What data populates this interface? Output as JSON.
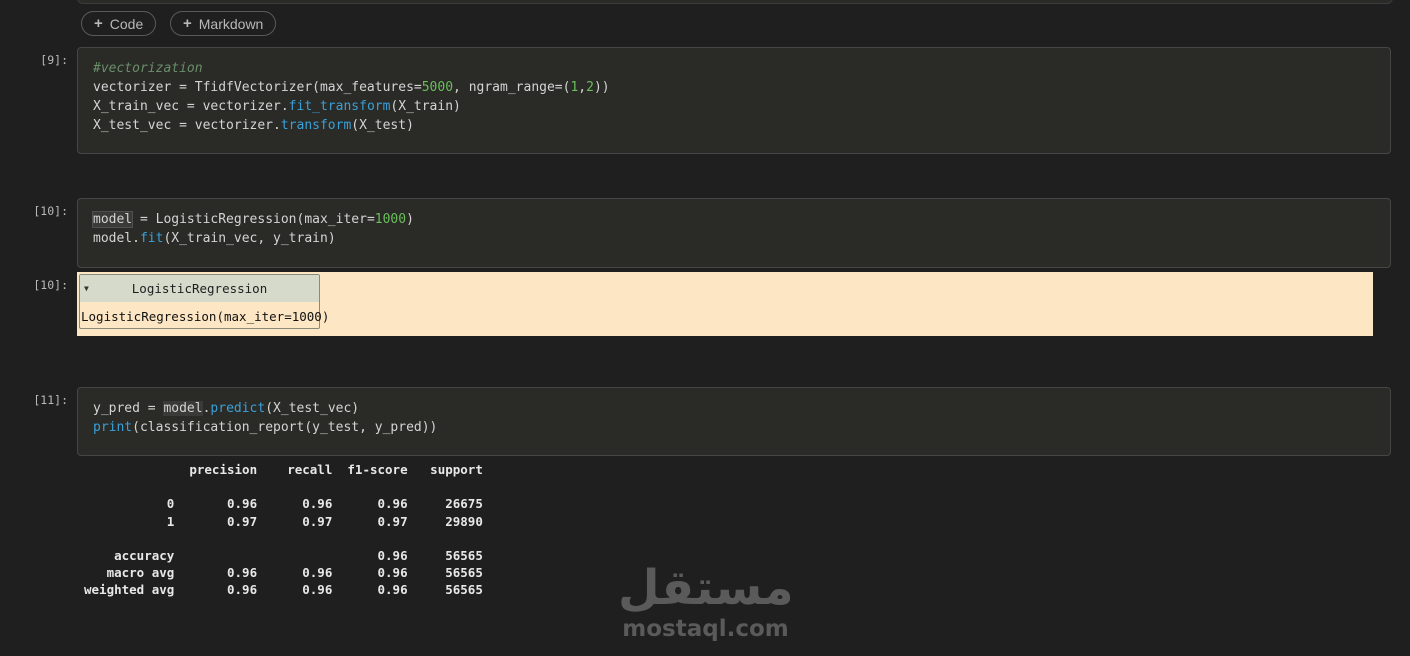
{
  "toolbar": {
    "add_code_label": "Code",
    "add_markdown_label": "Markdown"
  },
  "cells": {
    "vectorize": {
      "prompt": "[9]:",
      "lines": [
        [
          {
            "t": "#vectorization",
            "c": "comment"
          }
        ],
        [
          {
            "t": "vectorizer = TfidfVectorizer(max_features=",
            "c": "default"
          },
          {
            "t": "5000",
            "c": "num"
          },
          {
            "t": ", ngram_range=(",
            "c": "default"
          },
          {
            "t": "1",
            "c": "num"
          },
          {
            "t": ",",
            "c": "default"
          },
          {
            "t": "2",
            "c": "num"
          },
          {
            "t": "))",
            "c": "default"
          }
        ],
        [
          {
            "t": "X_train_vec = vectorizer.",
            "c": "default"
          },
          {
            "t": "fit_transform",
            "c": "func"
          },
          {
            "t": "(X_train)",
            "c": "default"
          }
        ],
        [
          {
            "t": "X_test_vec = vectorizer.",
            "c": "default"
          },
          {
            "t": "transform",
            "c": "func"
          },
          {
            "t": "(X_test)",
            "c": "default"
          }
        ]
      ]
    },
    "model": {
      "prompt": "[10]:",
      "lines": [
        [
          {
            "t": "model",
            "c": "hl"
          },
          {
            "t": " = LogisticRegression(max_iter=",
            "c": "default"
          },
          {
            "t": "1000",
            "c": "num"
          },
          {
            "t": ")",
            "c": "default"
          }
        ],
        [
          {
            "t": "model.",
            "c": "default"
          },
          {
            "t": "fit",
            "c": "func"
          },
          {
            "t": "(X_train_vec, y_train)",
            "c": "default"
          }
        ]
      ]
    },
    "model_output": {
      "prompt": "[10]:",
      "estimator_name": "LogisticRegression",
      "estimator_repr": "LogisticRegression(max_iter=1000)"
    },
    "predict": {
      "prompt": "[11]:",
      "lines": [
        [
          {
            "t": "y_pred = ",
            "c": "default"
          },
          {
            "t": "model",
            "c": "hl2"
          },
          {
            "t": ".",
            "c": "default"
          },
          {
            "t": "predict",
            "c": "func"
          },
          {
            "t": "(X_test_vec)",
            "c": "default"
          }
        ],
        [
          {
            "t": "print",
            "c": "builtin"
          },
          {
            "t": "(classification_report(y_test, y_pred))",
            "c": "default"
          }
        ]
      ]
    }
  },
  "report": {
    "lines": [
      "              precision    recall  f1-score   support",
      "",
      "           0       0.96      0.96      0.96     26675",
      "           1       0.97      0.97      0.97     29890",
      "",
      "    accuracy                           0.96     56565",
      "   macro avg       0.96      0.96      0.96     56565",
      "weighted avg       0.96      0.96      0.96     56565"
    ]
  },
  "watermark": {
    "logo": "مستقل",
    "text": "mostaql.com"
  },
  "colors": {
    "background": "#1f1f1f",
    "cell_bg": "#2a2a27",
    "output_widget_bg": "#fde6c4",
    "number": "#6abf5c",
    "function": "#3aa0d8",
    "comment": "#6a8f6a"
  }
}
